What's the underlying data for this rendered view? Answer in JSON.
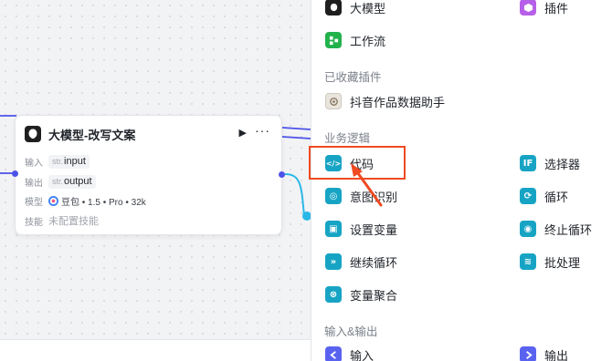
{
  "node": {
    "title": "大模型-改写文案",
    "inputs_label": "输入",
    "input_type": "str.",
    "input_name": "input",
    "outputs_label": "输出",
    "output_type": "str.",
    "output_name": "output",
    "model_label": "模型",
    "model_value": "豆包 • 1.5 • Pro • 32k",
    "skills_label": "技能",
    "skills_value": "未配置技能",
    "run_icon": "▶",
    "more_icon": "···"
  },
  "panel": {
    "items_top": [
      {
        "label": "大模型",
        "icon": "llm-icon",
        "color": "#1f1f1f"
      },
      {
        "label": "插件",
        "icon": "plugin-icon",
        "color": "#b65fe8"
      },
      {
        "label": "工作流",
        "icon": "workflow-icon",
        "color": "#22b24c"
      }
    ],
    "sections": {
      "favorites": "已收藏插件",
      "business_logic": "业务逻辑",
      "io": "输入&输出"
    },
    "favorites": [
      {
        "label": "抖音作品数据助手",
        "icon": "douyin-plugin-icon"
      }
    ],
    "logic": [
      {
        "label": "代码",
        "icon": "code-icon",
        "glyph": "</>",
        "color": "#17a4c4"
      },
      {
        "label": "选择器",
        "icon": "if-icon",
        "glyph": "IF",
        "color": "#17a4c4"
      },
      {
        "label": "意图识别",
        "icon": "intent-icon",
        "glyph": "◎",
        "color": "#17a4c4"
      },
      {
        "label": "循环",
        "icon": "loop-icon",
        "glyph": "⟳",
        "color": "#17a4c4"
      },
      {
        "label": "设置变量",
        "icon": "set-variable-icon",
        "glyph": "▣",
        "color": "#17a4c4"
      },
      {
        "label": "终止循环",
        "icon": "stop-loop-icon",
        "glyph": "◉",
        "color": "#17a4c4"
      },
      {
        "label": "继续循环",
        "icon": "continue-loop-icon",
        "glyph": "»",
        "color": "#17a4c4"
      },
      {
        "label": "批处理",
        "icon": "batch-icon",
        "glyph": "≋",
        "color": "#17a4c4"
      },
      {
        "label": "变量聚合",
        "icon": "variable-merge-icon",
        "glyph": "⊗",
        "color": "#17a4c4"
      }
    ],
    "io": [
      {
        "label": "输入",
        "icon": "input-icon",
        "color": "#5a63f0"
      },
      {
        "label": "输出",
        "icon": "output-icon",
        "color": "#5a63f0"
      }
    ]
  },
  "colors": {
    "highlight": "#ef4a21",
    "edge": "#4d53e8",
    "edge_cyan": "#2bb8e6"
  }
}
